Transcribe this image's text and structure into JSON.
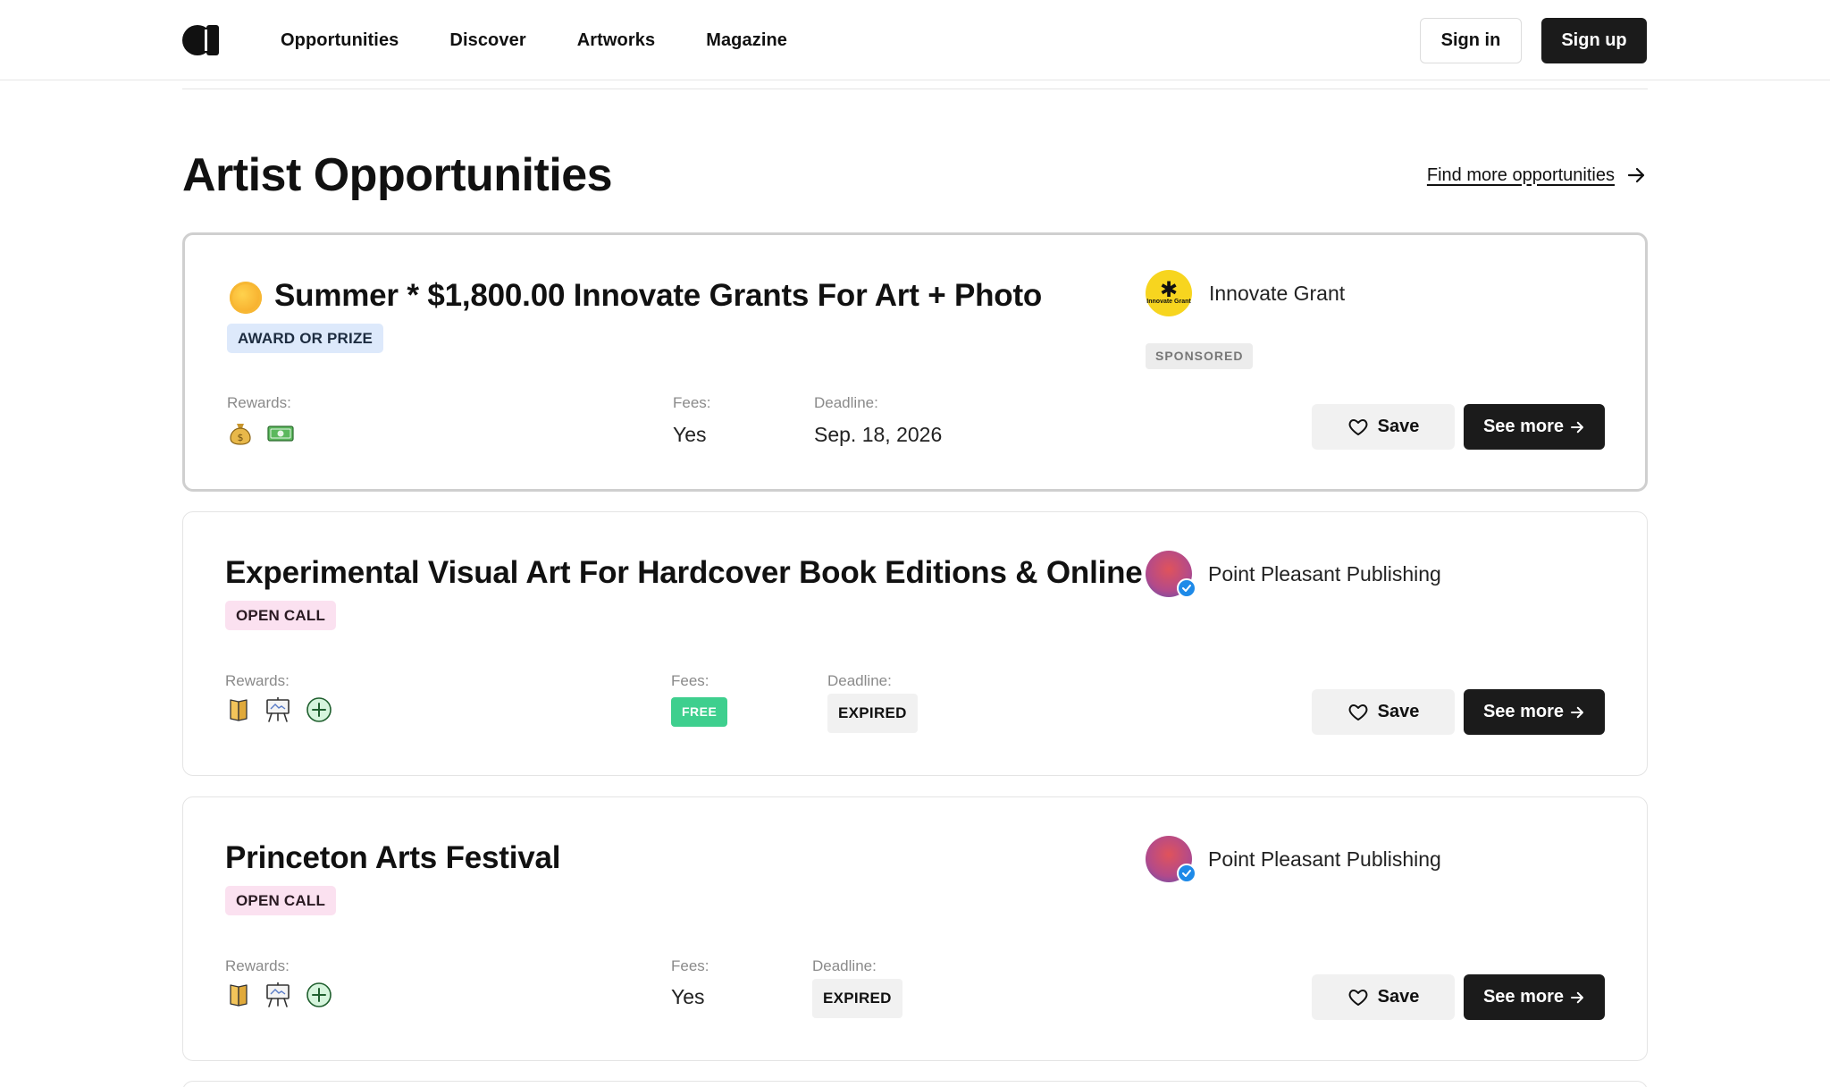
{
  "header": {
    "nav": [
      "Opportunities",
      "Discover",
      "Artworks",
      "Magazine"
    ],
    "sign_in": "Sign in",
    "sign_up": "Sign up"
  },
  "section": {
    "title": "Artist Opportunities",
    "find_more": "Find more opportunities"
  },
  "labels": {
    "rewards": "Rewards:",
    "fees": "Fees:",
    "deadline": "Deadline:",
    "save": "Save",
    "see_more": "See more"
  },
  "cards": [
    {
      "title": "Summer * $1,800.00 Innovate Grants For Art + Photo",
      "tag": "AWARD OR PRIZE",
      "org": "Innovate Grant",
      "org_logo_text": "Innovate Grant",
      "sponsored": "SPONSORED",
      "rewards_icons": [
        "money-bag-icon",
        "cash-icon"
      ],
      "fees": "Yes",
      "deadline": "Sep. 18, 2026"
    },
    {
      "title": "Experimental Visual Art For Hardcover Book Editions & Online",
      "tag": "OPEN CALL",
      "org": "Point Pleasant Publishing",
      "rewards_icons": [
        "book-icon",
        "easel-icon",
        "plus-circle-icon"
      ],
      "fees": "FREE",
      "deadline": "EXPIRED"
    },
    {
      "title": "Princeton Arts Festival",
      "tag": "OPEN CALL",
      "org": "Point Pleasant Publishing",
      "rewards_icons": [
        "book-icon",
        "easel-icon",
        "plus-circle-icon"
      ],
      "fees": "Yes",
      "deadline": "EXPIRED"
    }
  ],
  "colors": {
    "primary_button": "#1b1b1b",
    "award_tag": "#dde9fb",
    "open_call_tag": "#fbe1f0",
    "free_badge": "#3ecf8e",
    "verified": "#1e8ae8"
  }
}
